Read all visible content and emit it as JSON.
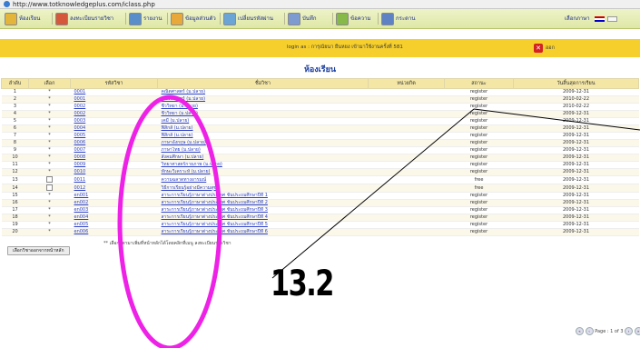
{
  "browser": {
    "url": "http://www.totknowledgeplus.com/iclass.php"
  },
  "nav": {
    "items": [
      {
        "label": "ห้องเรียน",
        "icon": "classroom-icon",
        "color": "#e3b53b"
      },
      {
        "label": "ลงทะเบียนรายวิชา",
        "icon": "register-icon",
        "color": "#d6583a"
      },
      {
        "label": "รายงาน",
        "icon": "report-icon",
        "color": "#5a8ecb"
      },
      {
        "label": "ข้อมูลส่วนตัว",
        "icon": "profile-icon",
        "color": "#e8a93a"
      },
      {
        "label": "เปลี่ยนรหัสผ่าน",
        "icon": "password-icon",
        "color": "#6aa5d6"
      },
      {
        "label": "บันทึก",
        "icon": "note-icon",
        "color": "#7d9bd1"
      },
      {
        "label": "ข้อความ",
        "icon": "message-icon",
        "color": "#86b84a"
      },
      {
        "label": "กระดาน",
        "icon": "board-icon",
        "color": "#5e82c4"
      }
    ],
    "language_label": "เลือกภาษา"
  },
  "login": {
    "text": "login as : การุณัยนา ยืนหยง เข้ามาใช้งานครั้งที่ 581",
    "logout_label": "ออก"
  },
  "page_title": "ห้องเรียน",
  "table": {
    "headers": [
      "ลำดับ",
      "เลือก",
      "รหัสวิชา",
      "ชื่อวิชา",
      "หน่วยกิต",
      "สถานะ",
      "วันสิ้นสุดการเรียน"
    ],
    "rows": [
      {
        "no": "1",
        "select": "*",
        "code": "0001",
        "name": "คณิตศาสตร์ (ม.ปลาย)",
        "credit": "",
        "status": "register",
        "end": "2009-12-31"
      },
      {
        "no": "2",
        "select": "*",
        "code": "0001",
        "name": "คณิตศาสตร์ (ม.ปลาย)",
        "credit": "",
        "status": "register",
        "end": "2010-02-22"
      },
      {
        "no": "3",
        "select": "*",
        "code": "0002",
        "name": "ชีววิทยา (ม.ปลาย)",
        "credit": "",
        "status": "register",
        "end": "2010-02-22"
      },
      {
        "no": "4",
        "select": "*",
        "code": "0002",
        "name": "ชีววิทยา (ม.ปลาย)",
        "credit": "",
        "status": "register",
        "end": "2009-12-31"
      },
      {
        "no": "5",
        "select": "*",
        "code": "0003",
        "name": "เคมี (ม.ปลาย)",
        "credit": "",
        "status": "register",
        "end": "2009-12-31"
      },
      {
        "no": "6",
        "select": "*",
        "code": "0004",
        "name": "ฟิสิกส์ (ม.ปลาย)",
        "credit": "",
        "status": "register",
        "end": "2009-12-31"
      },
      {
        "no": "7",
        "select": "*",
        "code": "0005",
        "name": "ฟิสิกส์ (ม.ปลาย)",
        "credit": "",
        "status": "register",
        "end": "2009-12-31"
      },
      {
        "no": "8",
        "select": "*",
        "code": "0006",
        "name": "ภาษาอังกฤษ (ม.ปลาย)",
        "credit": "",
        "status": "register",
        "end": "2009-12-31"
      },
      {
        "no": "9",
        "select": "*",
        "code": "0007",
        "name": "ภาษาไทย (ม.ปลาย)",
        "credit": "",
        "status": "register",
        "end": "2009-12-31"
      },
      {
        "no": "10",
        "select": "*",
        "code": "0008",
        "name": "สังคมศึกษา (ม.ปลาย)",
        "credit": "",
        "status": "register",
        "end": "2009-12-31"
      },
      {
        "no": "11",
        "select": "*",
        "code": "0009",
        "name": "วิทยาศาสตร์กายภาพ (ม.ปลาย)",
        "credit": "",
        "status": "register",
        "end": "2009-12-31"
      },
      {
        "no": "12",
        "select": "*",
        "code": "0010",
        "name": "ทักษะวิเคราะห์ (ม.ปลาย)",
        "credit": "",
        "status": "register",
        "end": "2009-12-31"
      },
      {
        "no": "13",
        "select": "box",
        "code": "0011",
        "name": "ความฉลาดทางอารมณ์",
        "credit": "",
        "status": "free",
        "end": "2009-12-31"
      },
      {
        "no": "14",
        "select": "box",
        "code": "0012",
        "name": "วิธีการเรียนรู้อย่างมีความสุข",
        "credit": "",
        "status": "free",
        "end": "2009-12-31"
      },
      {
        "no": "15",
        "select": "*",
        "code": "en001",
        "name": "สาระการเรียนรู้ภาษาต่างประเทศ ชั้นประถมศึกษาปีที่ 1",
        "credit": "",
        "status": "register",
        "end": "2009-12-31"
      },
      {
        "no": "16",
        "select": "*",
        "code": "en002",
        "name": "สาระการเรียนรู้ภาษาต่างประเทศ ชั้นประถมศึกษาปีที่ 2",
        "credit": "",
        "status": "register",
        "end": "2009-12-31"
      },
      {
        "no": "17",
        "select": "*",
        "code": "en003",
        "name": "สาระการเรียนรู้ภาษาต่างประเทศ ชั้นประถมศึกษาปีที่ 3",
        "credit": "",
        "status": "register",
        "end": "2009-12-31"
      },
      {
        "no": "18",
        "select": "*",
        "code": "en004",
        "name": "สาระการเรียนรู้ภาษาต่างประเทศ ชั้นประถมศึกษาปีที่ 4",
        "credit": "",
        "status": "register",
        "end": "2009-12-31"
      },
      {
        "no": "19",
        "select": "*",
        "code": "en005",
        "name": "สาระการเรียนรู้ภาษาต่างประเทศ ชั้นประถมศึกษาปีที่ 5",
        "credit": "",
        "status": "register",
        "end": "2009-12-31"
      },
      {
        "no": "20",
        "select": "*",
        "code": "en006",
        "name": "สาระการเรียนรู้ภาษาต่างประเทศ ชั้นประถมศึกษาปีที่ 6",
        "credit": "",
        "status": "register",
        "end": "2009-12-31"
      }
    ]
  },
  "footer": {
    "button_label": "เลือกวิชาออกจากหน้าหลัก",
    "note": "** เลือกวิชามาเพิ่มที่หน้าหลักได้โดยคลิกที่เมนู ลงทะเบียนรายวิชา",
    "pager": "Page : 1 of 3"
  },
  "annotation": {
    "label": "13.2",
    "ellipse_color": "#ee22e6"
  }
}
